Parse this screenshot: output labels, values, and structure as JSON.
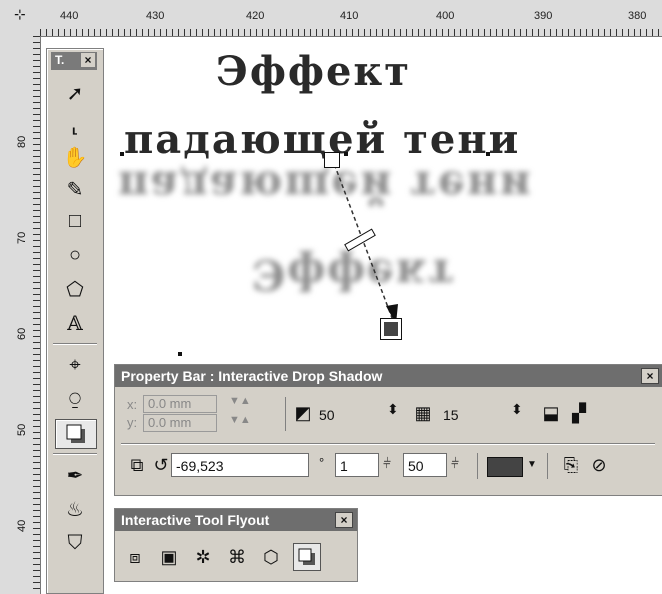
{
  "ruler": {
    "top_labels": [
      "440",
      "430",
      "420",
      "410",
      "400",
      "390",
      "380"
    ],
    "left_labels": [
      "80",
      "70",
      "60",
      "50",
      "40"
    ]
  },
  "toolbox": {
    "title": "T.",
    "close": "×"
  },
  "canvas": {
    "line1": "Эффект",
    "line2": "падающей тени"
  },
  "property_bar": {
    "title": "Property Bar : Interactive Drop Shadow",
    "close": "×",
    "x_label": "x:",
    "x_value": "0.0 mm",
    "y_label": "y:",
    "y_value": "0.0 mm",
    "opacity": "50",
    "feather": "15",
    "angle": "-69,523",
    "degree_symbol": "°",
    "stretch": "1",
    "fade": "50",
    "shadow_color": "#444444"
  },
  "flyout": {
    "title": "Interactive Tool Flyout",
    "close": "×"
  },
  "colors": {
    "panel_bg": "#d4d0c8",
    "titlebar_bg": "#6e6e6e",
    "ruler_bg": "#dcdcdc"
  }
}
